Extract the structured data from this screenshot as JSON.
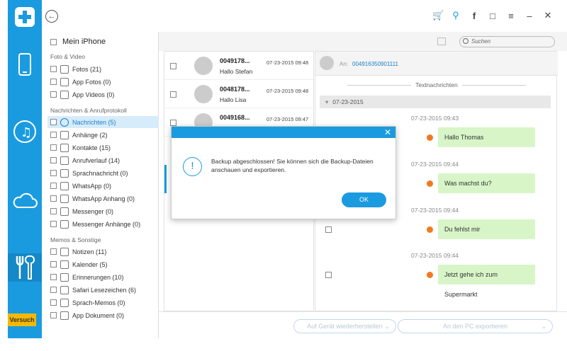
{
  "sidebar": {
    "device": "Mein iPhone",
    "sections": {
      "media": "Foto & Video",
      "messages": "Nachrichten & Anrufprotokoll",
      "memos": "Memos & Sonstige"
    },
    "items": [
      {
        "label": "Fotos (21)"
      },
      {
        "label": "App Fotos (0)"
      },
      {
        "label": "App Videos (0)"
      },
      {
        "label": "Nachrichten (5)"
      },
      {
        "label": "Anhänge (2)"
      },
      {
        "label": "Kontakte (15)"
      },
      {
        "label": "Anrufverlauf (14)"
      },
      {
        "label": "Sprachnachricht (0)"
      },
      {
        "label": "WhatsApp (0)"
      },
      {
        "label": "WhatsApp Anhang (0)"
      },
      {
        "label": "Messenger (0)"
      },
      {
        "label": "Messenger Anhänge (0)"
      },
      {
        "label": "Notizen (11)"
      },
      {
        "label": "Kalender (5)"
      },
      {
        "label": "Erinnerungen (10)"
      },
      {
        "label": "Safari Lesezeichen (6)"
      },
      {
        "label": "Sprach-Memos (0)"
      },
      {
        "label": "App Dokument (0)"
      }
    ]
  },
  "trial_badge": "Versuch",
  "search": {
    "placeholder": "Suchen"
  },
  "messages": [
    {
      "number": "0049178...",
      "name": "Hallo Stefan",
      "date": "07-23-2015 09:48"
    },
    {
      "number": "0048178...",
      "name": "Hallo Lisa",
      "date": "07-23-2015 09:48"
    },
    {
      "number": "0049168...",
      "name": "",
      "date": "07-23-2015 09:47"
    }
  ],
  "detail": {
    "to_label": "An:",
    "to_number": "004916350901111",
    "section_title": "Textnachrichten",
    "date_group": "07-23-2015",
    "conversation": [
      {
        "time": "07-23-2015 09:43",
        "text": "Hallo Thomas"
      },
      {
        "time": "07-23-2015 09:44",
        "text": "Was machst du?"
      },
      {
        "time": "07-23-2015 09:44",
        "text": "Du fehlst mir"
      },
      {
        "time": "07-23-2015 09:44",
        "text": "Jetzt gehe ich zum Supermarkt"
      }
    ]
  },
  "actions": {
    "restore": "Auf Gerät wiederherstellen",
    "export": "An den PC exportieren"
  },
  "dialog": {
    "message": "Backup abgeschlossen! Sie können sich die Backup-Dateien anschauen und exportieren.",
    "ok": "OK",
    "icon": "!"
  },
  "colors": {
    "accent": "#1a9be0",
    "bubble": "#d8f5c8",
    "warning": "#f07a20",
    "trial": "#f5b800"
  }
}
